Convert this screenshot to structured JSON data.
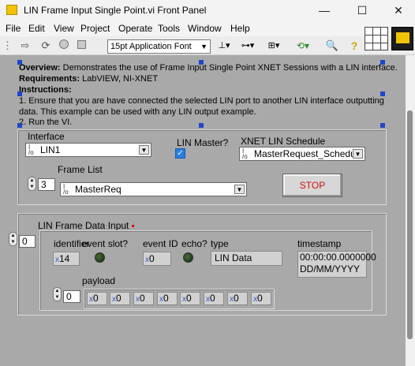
{
  "window": {
    "title": "LIN Frame Input Single Point.vi Front Panel",
    "minimize": "—",
    "maximize": "☐",
    "close": "✕"
  },
  "menu": [
    "File",
    "Edit",
    "View",
    "Project",
    "Operate",
    "Tools",
    "Window",
    "Help"
  ],
  "toolbar": {
    "font": "15pt Application Font"
  },
  "description": {
    "overview_label": "Overview:",
    "overview_text": " Demonstrates the use of Frame Input Single Point XNET Sessions with a LIN interface.",
    "requirements_label": "Requirements:",
    "requirements_text": " LabVIEW, NI-XNET",
    "instructions_label": "Instructions:",
    "line1": "1. Ensure that you are have connected the selected LIN port to another LIN interface outputting",
    "line2": "data. This example can be used with any LIN output example.",
    "line3": "2.  Run the VI."
  },
  "config": {
    "interface_label": "Interface",
    "interface_value": "LIN1",
    "lin_master_label": "LIN Master?",
    "lin_master_checked": "✓",
    "schedule_label": "XNET LIN Schedule",
    "schedule_value": "MasterRequest_Schedule",
    "frame_list_label": "Frame List",
    "frame_list_index": "3",
    "frame_list_value": "MasterReq",
    "stop_label": "STOP"
  },
  "frame_data": {
    "label": "LIN Frame Data Input",
    "index": "0",
    "identifier_label": "identifier",
    "identifier_value": "14",
    "event_slot_label": "event slot?",
    "event_id_label": "event ID",
    "event_id_value": "0",
    "echo_label": "echo?",
    "type_label": "type",
    "type_value": "LIN Data",
    "timestamp_label": "timestamp",
    "timestamp_line1": "00:00:00.0000000",
    "timestamp_line2": "DD/MM/YYYY",
    "payload_label": "payload",
    "payload_index": "0",
    "payload_values": [
      "0",
      "0",
      "0",
      "0",
      "0",
      "0",
      "0",
      "0"
    ],
    "hex_prefix": "x"
  }
}
